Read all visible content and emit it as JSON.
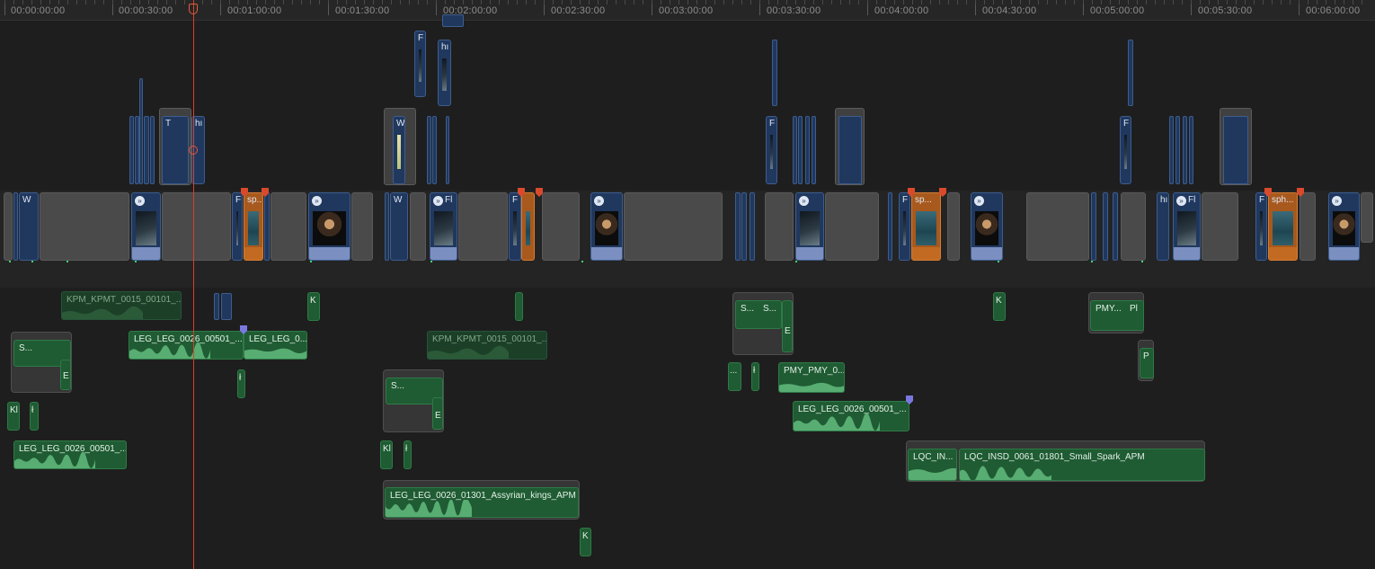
{
  "ruler": {
    "timecodes": [
      "00:00:00:00",
      "00:00:30:00",
      "00:01:00:00",
      "00:01:30:00",
      "00:02:00:00",
      "00:02:30:00",
      "00:03:00:00",
      "00:03:30:00",
      "00:04:00:00",
      "00:04:30:00",
      "00:05:00:00",
      "00:05:30:00",
      "00:06:00:00"
    ]
  },
  "connected_video": [
    {
      "label": "F"
    },
    {
      "label": "hı"
    },
    {
      "label": "T"
    },
    {
      "label": "hı"
    },
    {
      "label": "W"
    },
    {
      "label": "F"
    },
    {
      "label": "F"
    }
  ],
  "storyline": {
    "clips": [
      {
        "label": "W"
      },
      {
        "label": "F"
      },
      {
        "label": "sp..."
      },
      {
        "label": "W"
      },
      {
        "label": "Fl"
      },
      {
        "label": "F"
      },
      {
        "label": "F"
      },
      {
        "label": "sp..."
      },
      {
        "label": "hı"
      },
      {
        "label": "Fl"
      },
      {
        "label": "F"
      },
      {
        "label": "sph..."
      }
    ]
  },
  "audio": {
    "clips": [
      {
        "label": "KPM_KPMT_0015_00101_..."
      },
      {
        "label": "LEG_LEG_0026_00501_..."
      },
      {
        "label": "LEG_LEG_0..."
      },
      {
        "label": "KPM_KPMT_0015_00101_..."
      },
      {
        "label": "LEG_LEG_0026_00501_..."
      },
      {
        "label": "LEG_LEG_0026_01301_Assyrian_kings_APM"
      },
      {
        "label": "PMY_PMY_0..."
      },
      {
        "label": "LEG_LEG_0026_00501_..."
      },
      {
        "label": "LQC_IN..."
      },
      {
        "label": "LQC_INSD_0061_01801_Small_Spark_APM"
      },
      {
        "label": "PMY..."
      },
      {
        "label": "Pl"
      },
      {
        "label": "P"
      },
      {
        "label": "K"
      },
      {
        "label": "K"
      },
      {
        "label": "K"
      },
      {
        "label": "K"
      },
      {
        "label": "Kl"
      },
      {
        "label": "Kl"
      },
      {
        "label": "S..."
      },
      {
        "label": "S..."
      },
      {
        "label": "S..."
      },
      {
        "label": "S..."
      },
      {
        "label": "S..."
      },
      {
        "label": "S..."
      },
      {
        "label": "E"
      },
      {
        "label": "E"
      },
      {
        "label": "E"
      },
      {
        "label": "ł"
      },
      {
        "label": "ł"
      },
      {
        "label": "ł"
      },
      {
        "label": "ł"
      },
      {
        "label": "..."
      }
    ]
  },
  "colors": {
    "playhead": "#d9412b",
    "video_clip": "#20385e",
    "audio_clip": "#1f5b33",
    "title_clip": "#a8591d",
    "gap_clip": "#4a4a4a",
    "marker_red": "#d94a2c",
    "marker_purple": "#7a78e0"
  }
}
